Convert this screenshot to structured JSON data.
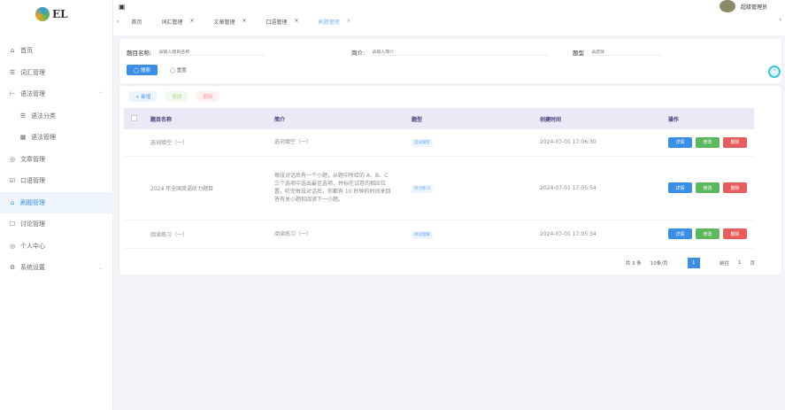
{
  "app": {
    "logo": "EL",
    "user": "超级管理员"
  },
  "sidebar": [
    {
      "label": "首页",
      "icon": "⌂"
    },
    {
      "label": "词汇管理",
      "icon": "☰"
    },
    {
      "label": "语法管理",
      "icon": "⊢",
      "arrow": "⌃"
    },
    {
      "label": "语法分类",
      "icon": "☰",
      "sub": true
    },
    {
      "label": "语法管理",
      "icon": "▦",
      "sub": true
    },
    {
      "label": "文章管理",
      "icon": "◎"
    },
    {
      "label": "口语管理",
      "icon": "☑"
    },
    {
      "label": "刷题管理",
      "icon": "⌂",
      "active": true
    },
    {
      "label": "讨论管理",
      "icon": "☐"
    },
    {
      "label": "个人中心",
      "icon": "◎"
    },
    {
      "label": "系统设置",
      "icon": "⚙",
      "arrow": "⌄"
    }
  ],
  "tabs": [
    {
      "label": "首页"
    },
    {
      "label": "词汇管理"
    },
    {
      "label": "文章管理"
    },
    {
      "label": "口语管理"
    },
    {
      "label": "刷题管理",
      "active": true
    }
  ],
  "search": {
    "name_label": "题目名称:",
    "name_placeholder": "请输入题目名称",
    "intro_label": "简介:",
    "intro_placeholder": "请输入简介",
    "type_label": "题型",
    "type_placeholder": "请选择",
    "search_btn": "◯ 搜索",
    "reset_btn": "◯ 重置"
  },
  "toolbar": {
    "add": "+ 新增",
    "edit": "修改",
    "delete": "删除"
  },
  "table": {
    "headers": [
      "题目名称",
      "简介",
      "题型",
      "创建时间",
      "操作"
    ],
    "rows": [
      {
        "name": "选词填空（一）",
        "intro": "选词填空（一）",
        "type": "选词填空",
        "time": "2024-07-01 17:06:30"
      },
      {
        "name": "2024 年全国英语听力题目",
        "intro": "每段对话后有一个小题，从题中所给的 A、B、C 三个选项中选出最佳选项，并标在试卷的相应位置。听完每段对话后，你都有 10 秒钟的时间来回答有关小题和阅读下一小题。",
        "type": "听力练习",
        "time": "2024-07-01 17:05:54"
      },
      {
        "name": "阅读练习（一）",
        "intro": "阅读练习（一）",
        "type": "阅读理解",
        "time": "2024-07-01 17:05:34"
      }
    ],
    "actions": {
      "detail": "详情",
      "edit": "修改",
      "delete": "删除"
    }
  },
  "pagination": {
    "total": "共 3 条",
    "size": "10条/页",
    "prev": "‹",
    "page": "1",
    "next": "›",
    "goto": "前往",
    "goto_value": "1",
    "unit": "页"
  }
}
